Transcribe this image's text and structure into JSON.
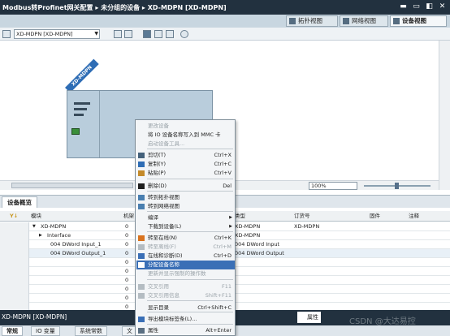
{
  "window": {
    "breadcrumb": "Modbus转Profinet网关配置 ▸ 未分组的设备 ▸ XD-MDPN [XD-MDPN]"
  },
  "view_tabs": [
    {
      "label": "拓扑视图",
      "active": false
    },
    {
      "label": "网络视图",
      "active": false
    },
    {
      "label": "设备视图",
      "active": true
    }
  ],
  "toolbar": {
    "device_select": "XD-MDPN [XD-MDPN]"
  },
  "canvas": {
    "device_label": "XD-MDPN",
    "zoom": "100%"
  },
  "overview": {
    "tab_label": "设备概览",
    "columns": [
      "模块",
      "机架",
      "类型",
      "订货号",
      "固件",
      "注释"
    ],
    "rows": [
      {
        "module": "XD-MDPN",
        "rack": "0",
        "type": "XD-MDPN",
        "order_no": "XD-MDPN",
        "expand": "▼"
      },
      {
        "module": "Interface",
        "rack": "0",
        "type": "XD-MDPN",
        "order_no": "",
        "expand": "▶"
      },
      {
        "module": "004 DWord Input_1",
        "rack": "0",
        "type": "004 DWord Input",
        "order_no": "",
        "expand": ""
      },
      {
        "module": "004 DWord Output_1",
        "rack": "0",
        "type": "004 DWord Output",
        "order_no": "",
        "expand": ""
      },
      {
        "module": "",
        "rack": "0",
        "type": "",
        "order_no": "",
        "expand": ""
      },
      {
        "module": "",
        "rack": "0",
        "type": "",
        "order_no": "",
        "expand": ""
      },
      {
        "module": "",
        "rack": "0",
        "type": "",
        "order_no": "",
        "expand": ""
      },
      {
        "module": "",
        "rack": "0",
        "type": "",
        "order_no": "",
        "expand": ""
      },
      {
        "module": "",
        "rack": "0",
        "type": "",
        "order_no": "",
        "expand": ""
      },
      {
        "module": "",
        "rack": "0",
        "type": "",
        "order_no": "",
        "expand": ""
      }
    ]
  },
  "context_menu": {
    "items": [
      {
        "label": "更改设备",
        "shortcut": "",
        "enabled": false
      },
      {
        "label": "将 IO 设备名称写入到 MMC 卡",
        "shortcut": "",
        "enabled": true
      },
      {
        "label": "启动设备工具...",
        "shortcut": "",
        "enabled": false
      },
      {
        "label": "剪切(T)",
        "shortcut": "Ctrl+X",
        "enabled": true,
        "icon": "cut-icon"
      },
      {
        "label": "复制(Y)",
        "shortcut": "Ctrl+C",
        "enabled": true,
        "icon": "copy-icon"
      },
      {
        "label": "粘贴(P)",
        "shortcut": "Ctrl+V",
        "enabled": true,
        "icon": "paste-icon"
      },
      {
        "label": "删除(D)",
        "shortcut": "Del",
        "enabled": true,
        "icon": "delete-icon"
      },
      {
        "label": "转到拓扑视图",
        "shortcut": "",
        "enabled": true,
        "icon": "topology-icon"
      },
      {
        "label": "转到网络视图",
        "shortcut": "",
        "enabled": true,
        "icon": "network-icon"
      },
      {
        "label": "编译",
        "shortcut": "",
        "enabled": true,
        "submenu": true
      },
      {
        "label": "下载到设备(L)",
        "shortcut": "",
        "enabled": true,
        "submenu": true
      },
      {
        "label": "转至在线(N)",
        "shortcut": "Ctrl+K",
        "enabled": true,
        "icon": "go-online-icon"
      },
      {
        "label": "转至离线(F)",
        "shortcut": "Ctrl+M",
        "enabled": false,
        "icon": "go-offline-icon"
      },
      {
        "label": "在线和诊断(D)",
        "shortcut": "Ctrl+D",
        "enabled": true,
        "icon": "diagnostics-icon"
      },
      {
        "label": "分配设备名称",
        "shortcut": "",
        "enabled": true,
        "highlighted": true,
        "icon": "assign-name-icon"
      },
      {
        "label": "更新并显示强制的操作数",
        "shortcut": "",
        "enabled": false
      },
      {
        "label": "交叉引用",
        "shortcut": "F11",
        "enabled": false,
        "icon": "cross-ref-icon"
      },
      {
        "label": "交叉引用信息",
        "shortcut": "Shift+F11",
        "enabled": false,
        "icon": "cross-ref-info-icon"
      },
      {
        "label": "显示目录",
        "shortcut": "Ctrl+Shift+C",
        "enabled": true
      },
      {
        "label": "导出模块标签条(L)...",
        "shortcut": "",
        "enabled": true,
        "icon": "export-icon"
      },
      {
        "label": "属性",
        "shortcut": "Alt+Enter",
        "enabled": true,
        "icon": "properties-icon"
      }
    ]
  },
  "inspector": {
    "title": "XD-MDPN [XD-MDPN]",
    "properties_tab": "属性",
    "tabs": [
      {
        "label": "常规",
        "active": true
      },
      {
        "label": "IO 变量",
        "active": false
      },
      {
        "label": "系统常数",
        "active": false
      },
      {
        "label": "文",
        "active": false
      }
    ]
  },
  "watermark": "CSDN @大达易控",
  "colors": {
    "title_bar": "#22313f",
    "device_body": "#b9cddc",
    "device_label_bg": "#2e6db5",
    "menu_highlight": "#3a6fb6",
    "port_green": "#3a8f3a"
  }
}
